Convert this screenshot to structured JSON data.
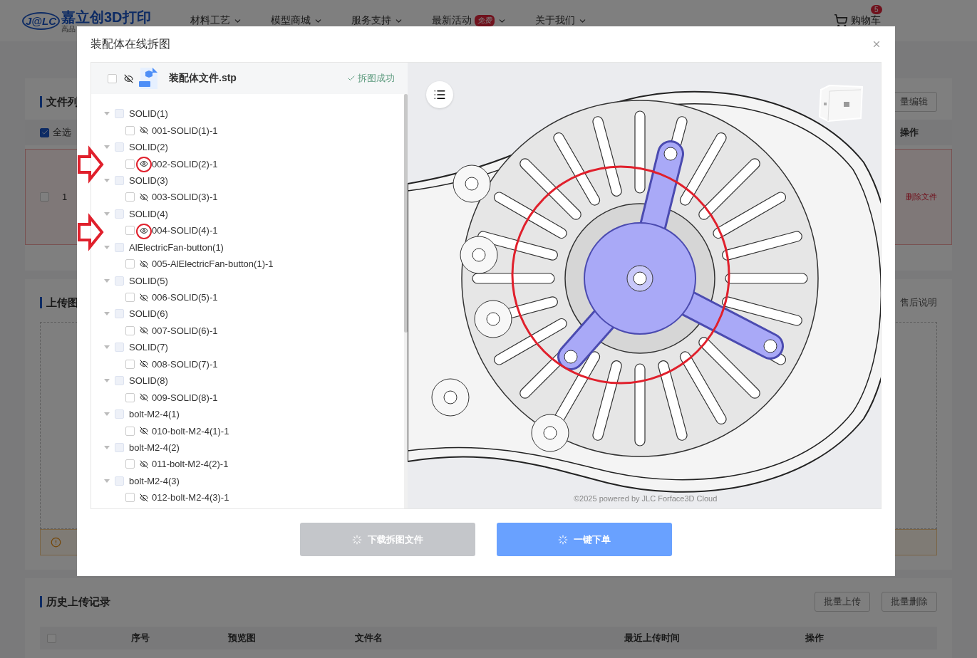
{
  "header": {
    "logo_mark": "J@LC",
    "brand": "嘉立创3D打印",
    "tagline": "高品",
    "nav": [
      {
        "label": "材料工艺"
      },
      {
        "label": "模型商城"
      },
      {
        "label": "服务支持"
      },
      {
        "label": "最新活动",
        "badge": "免费"
      },
      {
        "label": "关于我们"
      }
    ],
    "cart": {
      "label": "购物车",
      "badge": "5"
    }
  },
  "file_list": {
    "title": "文件列",
    "action": "量编辑",
    "select_all": {
      "label": "全选",
      "checked": true
    },
    "operation_heading": "操作",
    "rows": [
      {
        "index": "1",
        "checked": false,
        "action": "删除文件"
      }
    ]
  },
  "upload": {
    "title": "上传图",
    "link": "售后说明"
  },
  "history": {
    "title": "历史上传记录",
    "select_all": {
      "checked": false
    },
    "buttons": [
      "批量上传",
      "批量删除"
    ],
    "columns": [
      "序号",
      "预览图",
      "文件名",
      "最近上传时间",
      "操作"
    ]
  },
  "dialog": {
    "title": "装配体在线拆图",
    "file": {
      "name": "装配体文件.stp",
      "checked": false,
      "visible": false,
      "status": "拆图成功"
    },
    "tree": [
      {
        "label": "SOLID(1)",
        "checked": false,
        "expanded": true,
        "children": [
          {
            "label": "001-SOLID(1)-1",
            "checked": false,
            "visible": false
          }
        ]
      },
      {
        "label": "SOLID(2)",
        "checked": false,
        "expanded": true,
        "children": [
          {
            "label": "002-SOLID(2)-1",
            "checked": false,
            "visible": true
          }
        ]
      },
      {
        "label": "SOLID(3)",
        "checked": false,
        "expanded": true,
        "children": [
          {
            "label": "003-SOLID(3)-1",
            "checked": false,
            "visible": false
          }
        ]
      },
      {
        "label": "SOLID(4)",
        "checked": false,
        "expanded": true,
        "children": [
          {
            "label": "004-SOLID(4)-1",
            "checked": false,
            "visible": true
          }
        ]
      },
      {
        "label": "AlElectricFan-button(1)",
        "checked": false,
        "expanded": true,
        "children": [
          {
            "label": "005-AlElectricFan-button(1)-1",
            "checked": false,
            "visible": false
          }
        ]
      },
      {
        "label": "SOLID(5)",
        "checked": false,
        "expanded": true,
        "children": [
          {
            "label": "006-SOLID(5)-1",
            "checked": false,
            "visible": false
          }
        ]
      },
      {
        "label": "SOLID(6)",
        "checked": false,
        "expanded": true,
        "children": [
          {
            "label": "007-SOLID(6)-1",
            "checked": false,
            "visible": false
          }
        ]
      },
      {
        "label": "SOLID(7)",
        "checked": false,
        "expanded": true,
        "children": [
          {
            "label": "008-SOLID(7)-1",
            "checked": false,
            "visible": false
          }
        ]
      },
      {
        "label": "SOLID(8)",
        "checked": false,
        "expanded": true,
        "children": [
          {
            "label": "009-SOLID(8)-1",
            "checked": false,
            "visible": false
          }
        ]
      },
      {
        "label": "bolt-M2-4(1)",
        "checked": false,
        "expanded": true,
        "children": [
          {
            "label": "010-bolt-M2-4(1)-1",
            "checked": false,
            "visible": false
          }
        ]
      },
      {
        "label": "bolt-M2-4(2)",
        "checked": false,
        "expanded": true,
        "children": [
          {
            "label": "011-bolt-M2-4(2)-1",
            "checked": false,
            "visible": false
          }
        ]
      },
      {
        "label": "bolt-M2-4(3)",
        "checked": false,
        "expanded": true,
        "children": [
          {
            "label": "012-bolt-M2-4(3)-1",
            "checked": false,
            "visible": false
          }
        ]
      }
    ],
    "viewer": {
      "credit": "©2025 powered by JLC Forface3D Cloud"
    },
    "buttons": [
      {
        "label": "下载拆图文件",
        "kind": "secondary",
        "loading": true
      },
      {
        "label": "一键下单",
        "kind": "primary",
        "loading": true
      }
    ]
  }
}
